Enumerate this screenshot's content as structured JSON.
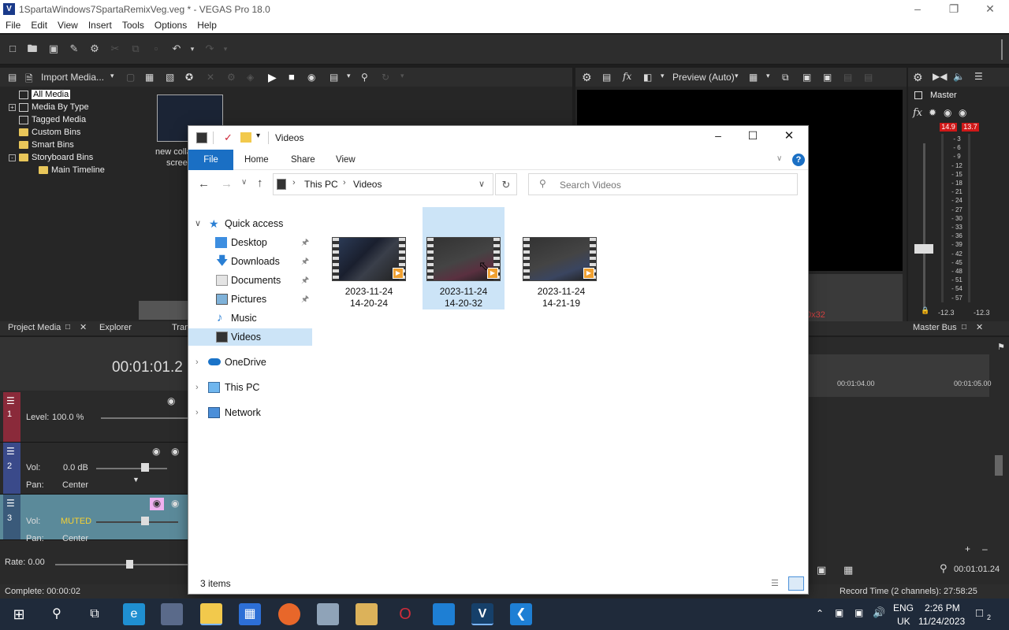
{
  "vegas": {
    "title": "1SpartaWindows7SpartaRemixVeg.veg * - VEGAS Pro 18.0",
    "logo": "V",
    "menu": [
      "File",
      "Edit",
      "View",
      "Insert",
      "Tools",
      "Options",
      "Help"
    ],
    "media_toolbar": {
      "import_label": "Import Media..."
    },
    "preview_toolbar": {
      "preview_mode": "Preview (Auto)"
    },
    "master": {
      "label": "Master",
      "peak_left": "14.9",
      "peak_right": "13.7",
      "scale": [
        "3",
        "6",
        "9",
        "12",
        "15",
        "18",
        "21",
        "24",
        "27",
        "30",
        "33",
        "36",
        "39",
        "42",
        "45",
        "48",
        "51",
        "54",
        "57"
      ],
      "level_left": "-12.3",
      "level_right": "-12.3"
    },
    "media_tree": [
      {
        "label": "All Media",
        "selected": true
      },
      {
        "label": "Media By Type",
        "expander": "+"
      },
      {
        "label": "Tagged Media"
      },
      {
        "label": "Custom Bins"
      },
      {
        "label": "Smart Bins"
      },
      {
        "label": "Storyboard Bins",
        "expander": "-"
      },
      {
        "label": "Main Timeline"
      }
    ],
    "media_item": {
      "caption_line1": "new colla",
      "caption_line2": "scree"
    },
    "preview_res_fragment": "0x32",
    "tabs": {
      "project_media": "Project Media",
      "explorer": "Explorer",
      "transitions_fragment": "Tran",
      "master_bus": "Master Bus"
    },
    "timecode": "00:01:01.2",
    "ruler": [
      "00:01:04.00",
      "00:01:05.00"
    ],
    "tracks": [
      {
        "num": "1",
        "level_label": "Level:",
        "level_value": "100.0 %"
      },
      {
        "num": "2",
        "vol_label": "Vol:",
        "vol_value": "0.0 dB",
        "pan_label": "Pan:",
        "pan_value": "Center"
      },
      {
        "num": "3",
        "vol_label": "Vol:",
        "vol_value": "MUTED",
        "pan_label": "Pan:",
        "pan_value": "Center"
      }
    ],
    "rate": "Rate: 0.00",
    "cursor_time": "00:01:01.24",
    "status_left": "Complete: 00:00:02",
    "status_right": "Record Time (2 channels): 27:58:25"
  },
  "explorer": {
    "title": "Videos",
    "ribbon_tabs": [
      "File",
      "Home",
      "Share",
      "View"
    ],
    "breadcrumb": [
      "This PC",
      "Videos"
    ],
    "search_placeholder": "Search Videos",
    "nav": {
      "quick_access": "Quick access",
      "pinned": [
        "Desktop",
        "Downloads",
        "Documents",
        "Pictures"
      ],
      "unpinned": [
        "Music",
        "Videos"
      ],
      "onedrive": "OneDrive",
      "this_pc": "This PC",
      "network": "Network"
    },
    "files": [
      {
        "line1": "2023-11-24",
        "line2": "14-20-24",
        "selected": false
      },
      {
        "line1": "2023-11-24",
        "line2": "14-20-32",
        "selected": true
      },
      {
        "line1": "2023-11-24",
        "line2": "14-21-19",
        "selected": false
      }
    ],
    "item_count": "3 items"
  },
  "taskbar": {
    "lang_line1": "ENG",
    "lang_line2": "UK",
    "time": "2:26 PM",
    "date": "11/24/2023",
    "notifications": "2"
  }
}
